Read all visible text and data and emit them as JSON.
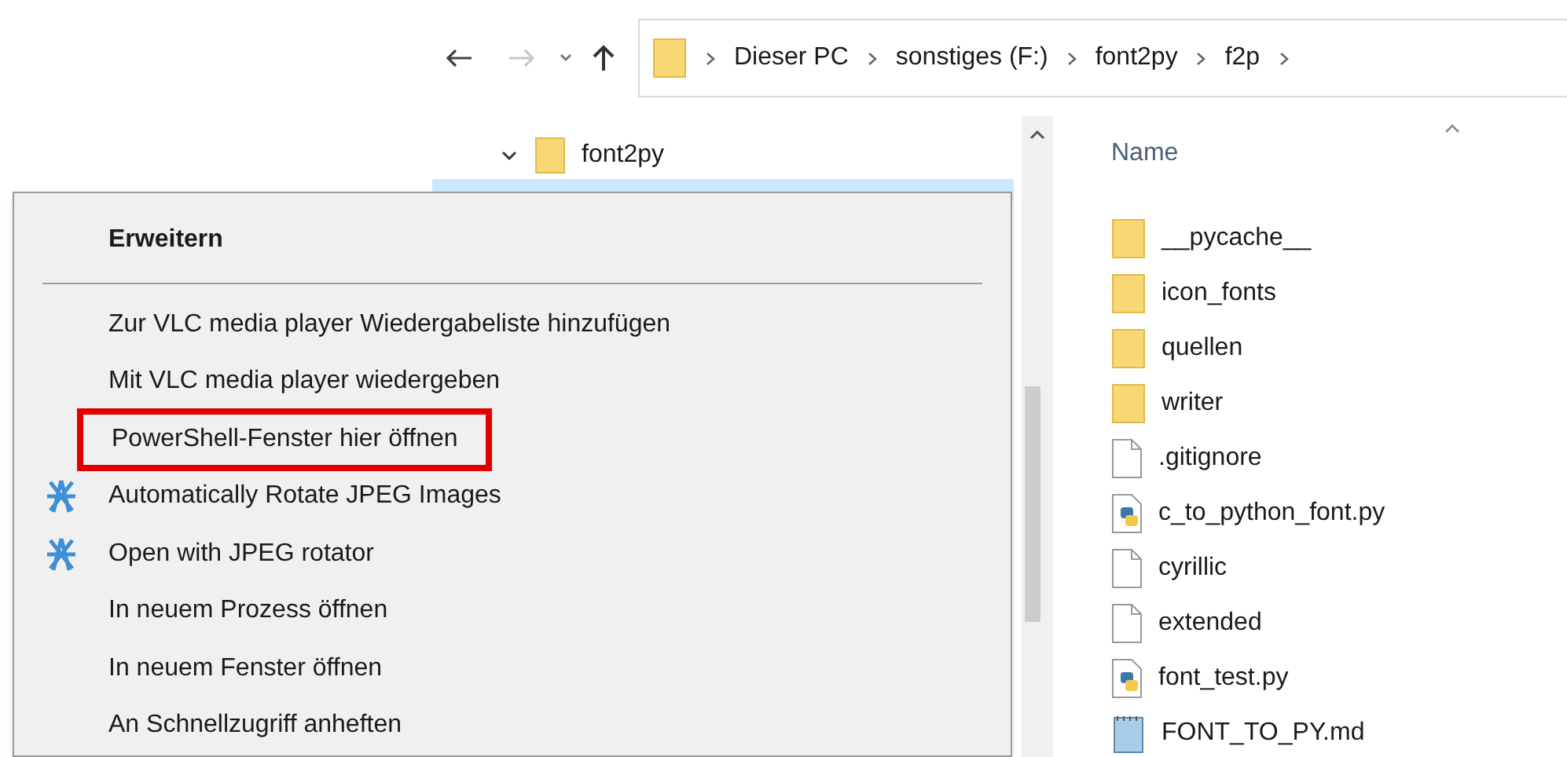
{
  "navigation": {
    "back": {
      "disabled": false
    },
    "forward": {
      "disabled": true
    }
  },
  "address_bar": {
    "segments": [
      "Dieser PC",
      "sonstiges (F:)",
      "font2py",
      "f2p"
    ]
  },
  "tree": {
    "items": [
      {
        "label": "font2py",
        "expanded": true,
        "selected": false
      }
    ]
  },
  "file_list": {
    "column_header": "Name",
    "sorted_ascending": true,
    "files": [
      {
        "name": "__pycache__",
        "kind": "folder"
      },
      {
        "name": "icon_fonts",
        "kind": "folder"
      },
      {
        "name": "quellen",
        "kind": "folder"
      },
      {
        "name": "writer",
        "kind": "folder"
      },
      {
        "name": ".gitignore",
        "kind": "file"
      },
      {
        "name": "c_to_python_font.py",
        "kind": "python"
      },
      {
        "name": "cyrillic",
        "kind": "file"
      },
      {
        "name": "extended",
        "kind": "file"
      },
      {
        "name": "font_test.py",
        "kind": "python"
      },
      {
        "name": "FONT_TO_PY.md",
        "kind": "text"
      }
    ]
  },
  "context_menu": {
    "items": [
      {
        "label": "Erweitern",
        "kind": "header"
      },
      {
        "kind": "separator"
      },
      {
        "label": "Zur VLC media player Wiedergabeliste hinzufügen",
        "kind": "item",
        "highlighted": false
      },
      {
        "label": "Mit VLC media player wiedergeben",
        "kind": "item",
        "highlighted": false
      },
      {
        "label": "PowerShell-Fenster hier öffnen",
        "kind": "item",
        "highlighted": true
      },
      {
        "label": "Automatically Rotate JPEG Images",
        "kind": "rotator",
        "highlighted": false
      },
      {
        "label": "Open with JPEG rotator",
        "kind": "rotator",
        "highlighted": false
      },
      {
        "label": "In neuem Prozess öffnen",
        "kind": "item",
        "highlighted": false
      },
      {
        "label": "In neuem Fenster öffnen",
        "kind": "item",
        "highlighted": false
      },
      {
        "label": "An Schnellzugriff anheften",
        "kind": "item",
        "highlighted": false
      }
    ]
  }
}
